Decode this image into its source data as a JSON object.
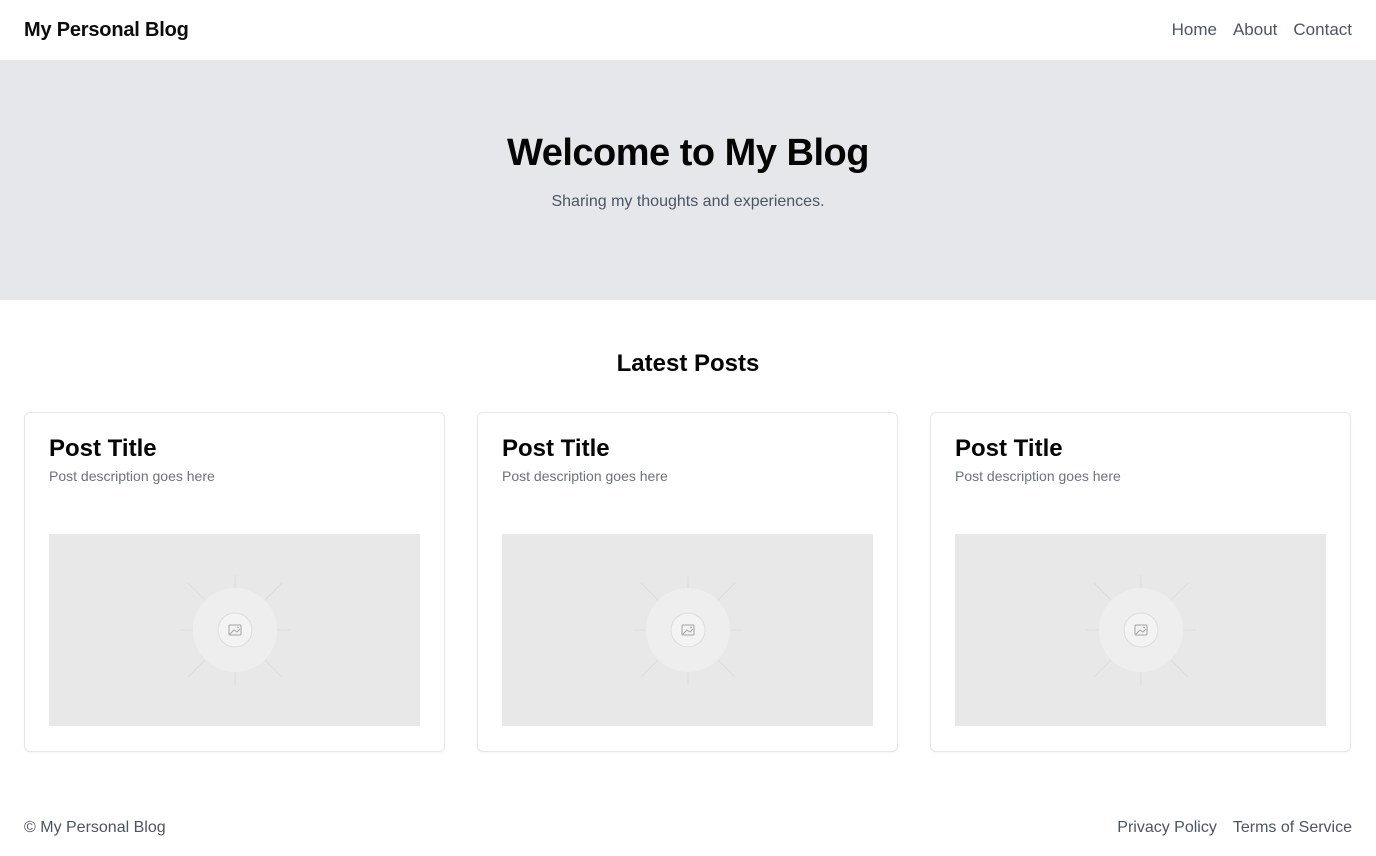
{
  "header": {
    "brand": "My Personal Blog",
    "nav": [
      {
        "label": "Home"
      },
      {
        "label": "About"
      },
      {
        "label": "Contact"
      }
    ]
  },
  "hero": {
    "title": "Welcome to My Blog",
    "subtitle": "Sharing my thoughts and experiences."
  },
  "posts": {
    "heading": "Latest Posts",
    "items": [
      {
        "title": "Post Title",
        "description": "Post description goes here",
        "image_icon": "image-icon"
      },
      {
        "title": "Post Title",
        "description": "Post description goes here",
        "image_icon": "image-icon"
      },
      {
        "title": "Post Title",
        "description": "Post description goes here",
        "image_icon": "image-icon"
      }
    ]
  },
  "footer": {
    "copyright": "© My Personal Blog",
    "links": [
      {
        "label": "Privacy Policy"
      },
      {
        "label": "Terms of Service"
      }
    ]
  }
}
